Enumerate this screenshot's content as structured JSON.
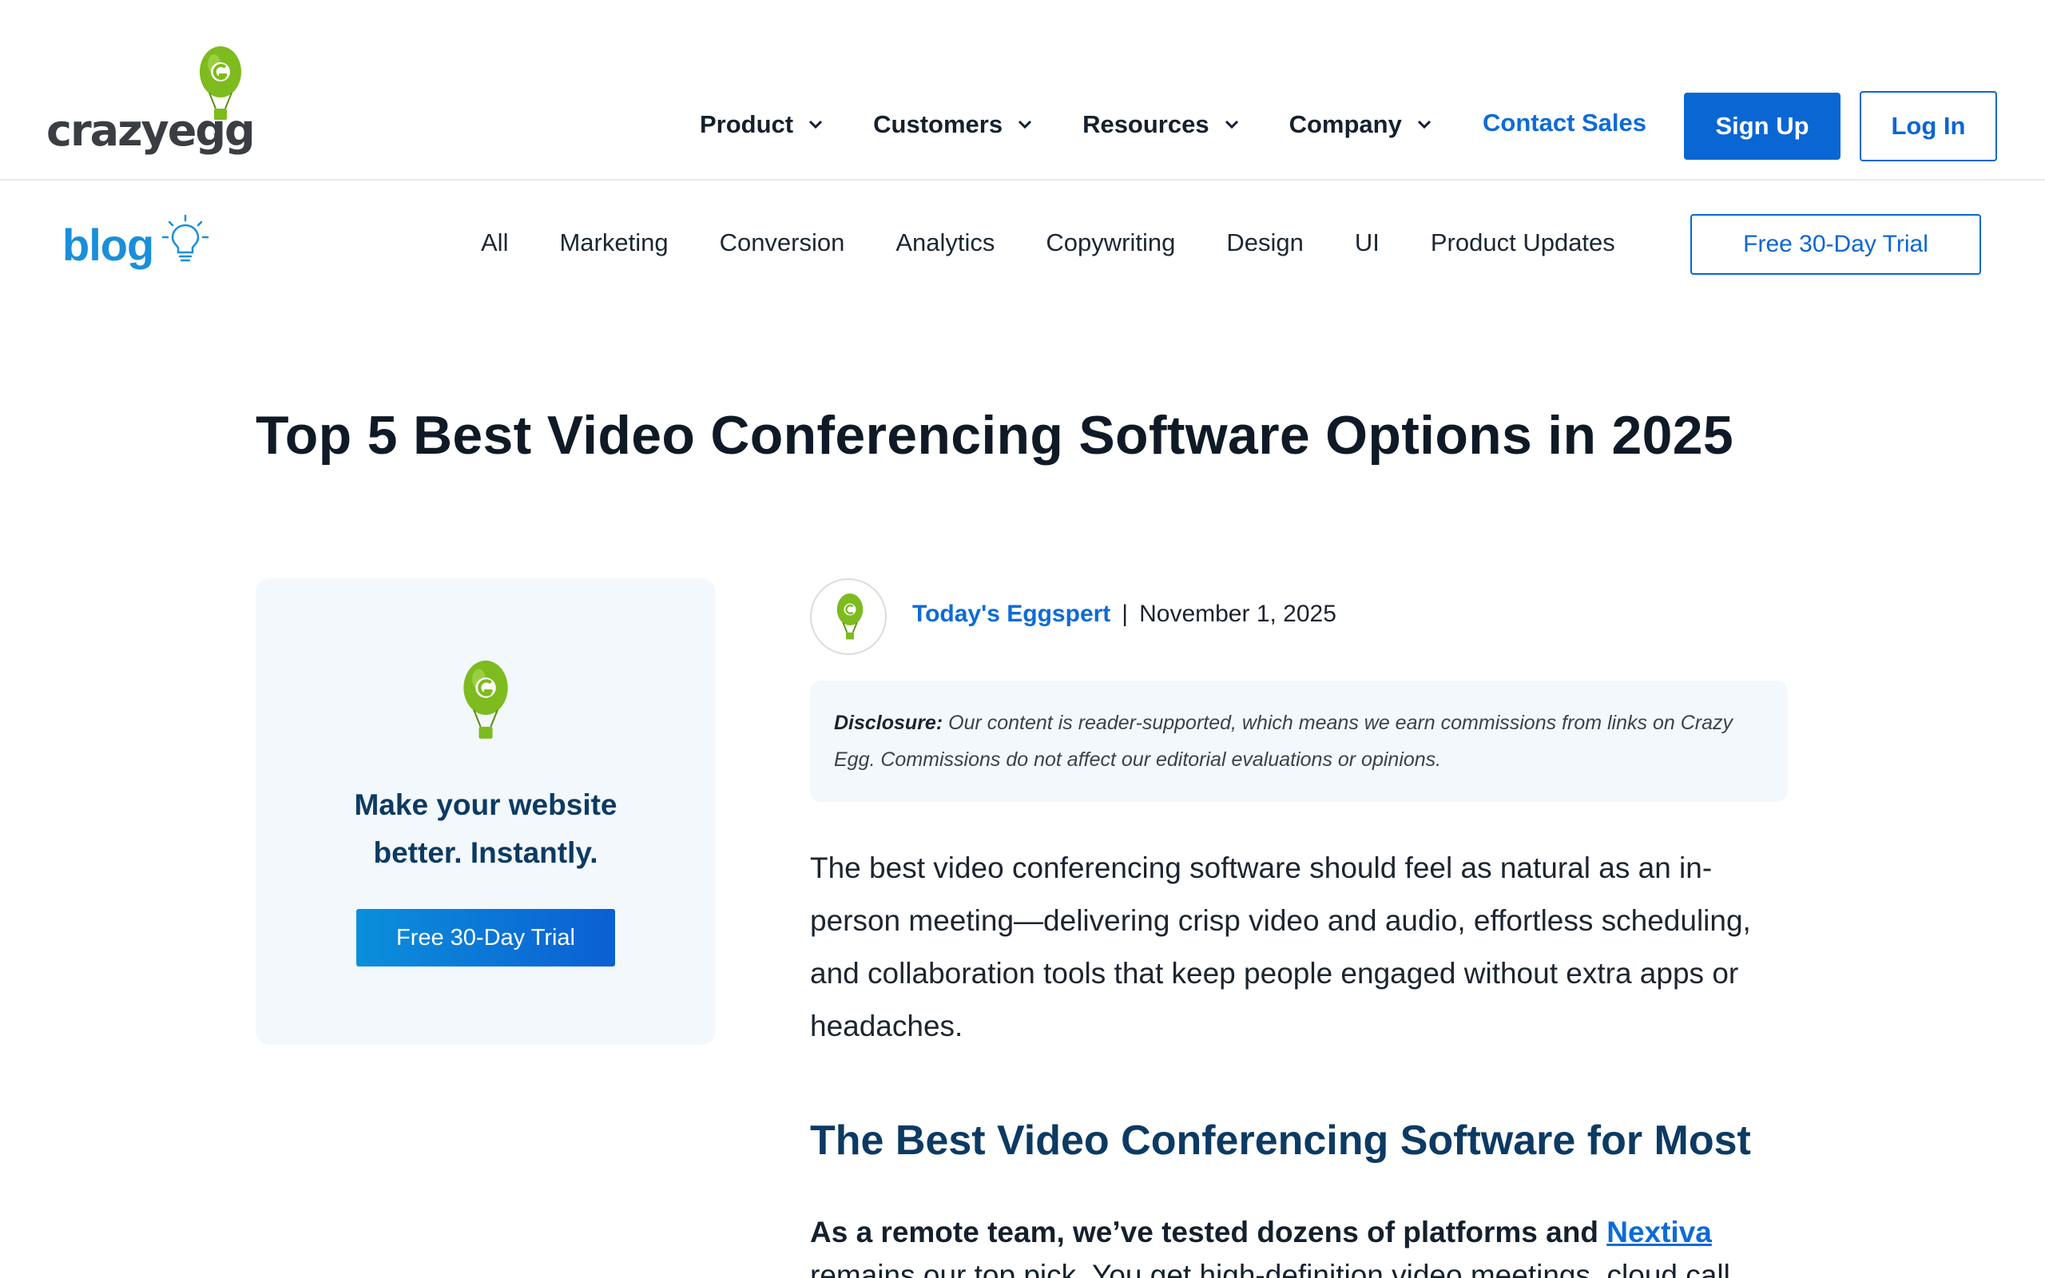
{
  "header": {
    "logo_text": "crazyegg",
    "logo_tm": "™",
    "nav": [
      {
        "label": "Product"
      },
      {
        "label": "Customers"
      },
      {
        "label": "Resources"
      },
      {
        "label": "Company"
      }
    ],
    "contact_sales": "Contact Sales",
    "sign_up": "Sign Up",
    "log_in": "Log In"
  },
  "blog_nav": {
    "logo_text": "blog",
    "categories": [
      "All",
      "Marketing",
      "Conversion",
      "Analytics",
      "Copywriting",
      "Design",
      "UI",
      "Product Updates"
    ],
    "trial_button": "Free 30-Day Trial"
  },
  "article": {
    "title": "Top 5 Best Video Conferencing Software Options in 2025",
    "author": "Today's Eggspert",
    "separator": "|",
    "date": "November 1, 2025",
    "disclosure_label": "Disclosure:",
    "disclosure_text": " Our content is reader-supported, which means we earn commissions from links on Crazy Egg. Commissions do not affect our editorial evaluations or opinions.",
    "intro": "The best video conferencing software should feel as natural as an in-person meeting—delivering crisp video and audio, effortless scheduling, and collaboration tools that keep people engaged without extra apps or headaches.",
    "section_heading": "The Best Video Conferencing Software for Most",
    "bold_line_prefix": "As a remote team, we’ve tested dozens of platforms and ",
    "bold_line_link": "Nextiva",
    "partial_line": "remains our top pick. You get high-definition video meetings, cloud call"
  },
  "sidebar": {
    "cta_line1": "Make your website",
    "cta_line2": "better. Instantly.",
    "cta_button": "Free 30-Day Trial"
  },
  "colors": {
    "brand_blue": "#0a66d3",
    "link_blue": "#0d6bd6",
    "heading_navy": "#0c3a63",
    "egg_green": "#7dbb1e",
    "blog_blue": "#1a8fd9"
  },
  "icons": [
    "chevron-down-icon",
    "balloon-logo-icon",
    "lightbulb-icon"
  ]
}
